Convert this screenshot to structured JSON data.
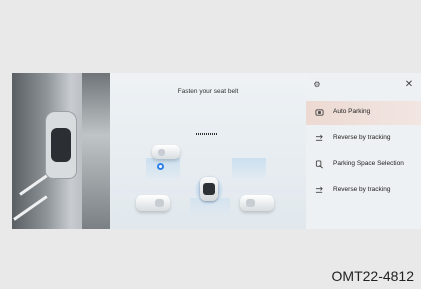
{
  "parking_screen": {
    "prompt": "Fasten your seat belt",
    "menu": [
      {
        "label": "Auto Parking",
        "icon": "auto-parking-icon",
        "active": true
      },
      {
        "label": "Reverse by tracking",
        "icon": "reverse-tracking-icon",
        "active": false
      },
      {
        "label": "Parking Space Selection",
        "icon": "parking-space-icon",
        "active": false
      },
      {
        "label": "Reverse by tracking",
        "icon": "reverse-tracking-icon",
        "active": false
      }
    ],
    "settings_icon": "gear-icon",
    "close_icon": "close-icon",
    "colors": {
      "active_item": "#ecd9d2",
      "ego_glow": "#4696f0",
      "pin": "#2f7fe8"
    }
  },
  "figure_code": "OMT22-4812"
}
